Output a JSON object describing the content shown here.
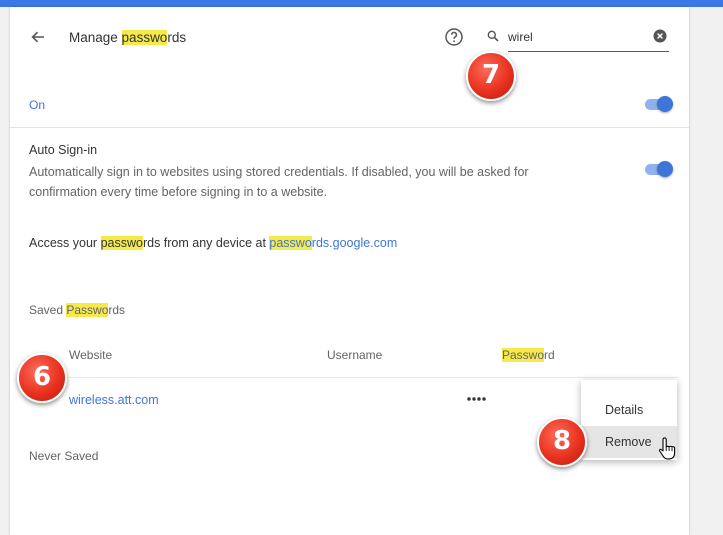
{
  "header": {
    "title_pre": "Manage ",
    "title_hl": "passwo",
    "title_post": "rds"
  },
  "search": {
    "value": "wirel"
  },
  "badges": [
    "7",
    "6",
    "8"
  ],
  "toggle_on": {
    "label": "On",
    "checked": true
  },
  "auto_signin": {
    "title": "Auto Sign-in",
    "description": "Automatically sign in to websites using stored credentials. If disabled, you will be asked for confirmation every time before signing in to a website.",
    "checked": true
  },
  "access": {
    "pre": "Access your ",
    "hl1": "passwo",
    "mid": "rds from any device at ",
    "link_hl": "passwo",
    "link_rest": "rds.google.com"
  },
  "saved": {
    "header_pre": "Saved ",
    "header_hl": "Passwo",
    "header_post": "rds",
    "columns": {
      "website": "Website",
      "username": "Username",
      "password_hl": "Passwo",
      "password_post": "rd"
    },
    "rows": [
      {
        "website": "wireless.att.com",
        "username": "",
        "password": ""
      }
    ]
  },
  "never_saved": {
    "header": "Never Saved"
  },
  "context_menu": {
    "items": [
      "Details",
      "Remove"
    ],
    "hovered": "Remove"
  },
  "colors": {
    "accent": "#3f75d6",
    "highlight": "#f6e94a",
    "badge": "#e8321f"
  },
  "icons": {
    "back": "arrow-back-icon",
    "help": "help-circle-icon",
    "search": "search-icon",
    "clear": "clear-circle-icon",
    "more": "more-horiz-icon",
    "cursor": "hand-pointer-icon"
  }
}
